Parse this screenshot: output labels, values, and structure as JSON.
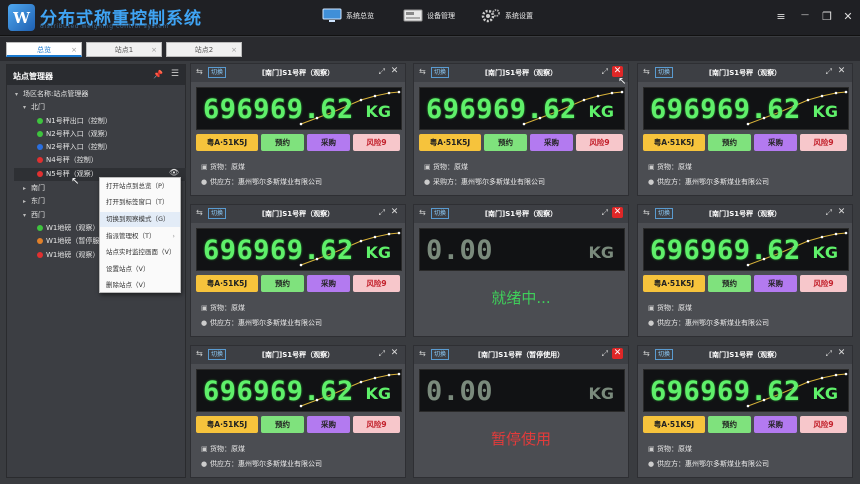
{
  "app": {
    "title": "分布式称重控制系统",
    "subtitle": "distributed weighing control system",
    "logo_text": "W"
  },
  "topnav": [
    {
      "label": "系统总览",
      "icon": "monitor-icon"
    },
    {
      "label": "设备管理",
      "icon": "device-icon"
    },
    {
      "label": "系统设置",
      "icon": "gear-icon"
    }
  ],
  "window_controls": {
    "menu": "≡",
    "minimize": "—",
    "maximize": "❐",
    "close": "✕"
  },
  "tabs": [
    {
      "label": "总览",
      "active": true
    },
    {
      "label": "站点1",
      "active": false
    },
    {
      "label": "站点2",
      "active": false
    }
  ],
  "sidebar": {
    "title": "站点管理器",
    "root": "场区名称:站点管理器",
    "groups": {
      "north": "北门",
      "south": "南门",
      "east": "东门",
      "west": "西门"
    },
    "north_items": [
      {
        "label": "N1号秤出口（控制）",
        "color": "#3ec43e"
      },
      {
        "label": "N2号秤入口（观察）",
        "color": "#3ec43e"
      },
      {
        "label": "N2号秤入口（控制）",
        "color": "#2a6fe0"
      },
      {
        "label": "N4号秤（控制）",
        "color": "#e03030"
      },
      {
        "label": "N5号秤（观察）",
        "color": "#e03030"
      }
    ],
    "west_items": [
      {
        "label": "W1地磅（观察）",
        "color": "#3ec43e"
      },
      {
        "label": "W1地磅（暂停服",
        "color": "#e0802a"
      },
      {
        "label": "W1地磅（观察）",
        "color": "#e03030"
      }
    ]
  },
  "context_menu": [
    "打开站点到总览（P）",
    "打开到标签窗口（T）",
    "切换到观察模式（G）",
    "指派管理权（T）",
    "站点实时监控画面（V）",
    "设置站点（V）",
    "删除站点（V）"
  ],
  "card_common": {
    "switch_label": "切换",
    "unit": "KG",
    "plate": "粤A·51K5J",
    "btn_reserve": "预约",
    "btn_purchase": "采购",
    "btn_risk": "风险9",
    "cargo": "货物：原煤",
    "supplier": "供应方：惠州鄂尔多斯煤业有限公司",
    "buyer": "采购方：惠州鄂尔多斯煤业有限公司"
  },
  "cards": [
    {
      "title": "[南门]S1号秤（观察）",
      "weight": "696969.62",
      "mode": "active",
      "party": "supplier",
      "close_red": false
    },
    {
      "title": "[南门]S1号秤（观察）",
      "weight": "696969.62",
      "mode": "active",
      "party": "buyer",
      "close_red": true
    },
    {
      "title": "[南门]S1号秤（观察）",
      "weight": "696969.62",
      "mode": "active",
      "party": "supplier",
      "close_red": false
    },
    {
      "title": "[南门]S1号秤（观察）",
      "weight": "696969.62",
      "mode": "active",
      "party": "supplier",
      "close_red": false
    },
    {
      "title": "[南门]S1号秤（观察）",
      "weight": "0.00",
      "mode": "ready",
      "status": "就绪中...",
      "status_color": "#3fcf5a",
      "close_red": true
    },
    {
      "title": "[南门]S1号秤（观察）",
      "weight": "696969.62",
      "mode": "active",
      "party": "supplier",
      "close_red": false
    },
    {
      "title": "[南门]S1号秤（观察）",
      "weight": "696969.62",
      "mode": "active",
      "party": "supplier",
      "close_red": false
    },
    {
      "title": "[南门]S1号秤（暂停使用）",
      "weight": "0.00",
      "mode": "paused",
      "status": "暂停使用",
      "status_color": "#e23b3b",
      "close_red": true
    },
    {
      "title": "[南门]S1号秤（观察）",
      "weight": "696969.62",
      "mode": "active",
      "party": "supplier",
      "close_red": false
    }
  ]
}
